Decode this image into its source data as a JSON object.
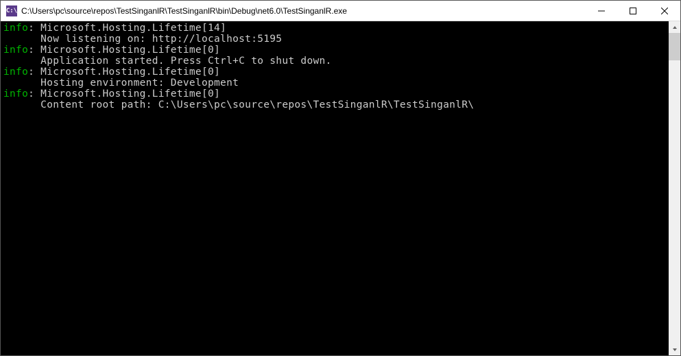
{
  "window": {
    "icon_text": "C:\\",
    "title": "C:\\Users\\pc\\source\\repos\\TestSinganlR\\TestSinganlR\\bin\\Debug\\net6.0\\TestSinganlR.exe"
  },
  "log": {
    "level_label": "info",
    "separator": ": ",
    "lines": [
      {
        "source": "Microsoft.Hosting.Lifetime[14]",
        "message": "Now listening on: http://localhost:5195"
      },
      {
        "source": "Microsoft.Hosting.Lifetime[0]",
        "message": "Application started. Press Ctrl+C to shut down."
      },
      {
        "source": "Microsoft.Hosting.Lifetime[0]",
        "message": "Hosting environment: Development"
      },
      {
        "source": "Microsoft.Hosting.Lifetime[0]",
        "message": "Content root path: C:\\Users\\pc\\source\\repos\\TestSinganlR\\TestSinganlR\\"
      }
    ]
  }
}
